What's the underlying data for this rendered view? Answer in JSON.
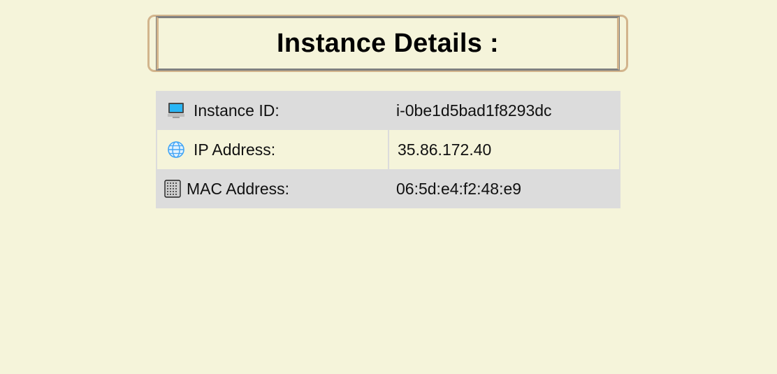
{
  "header": {
    "title": "Instance Details :"
  },
  "details": [
    {
      "icon": "computer-icon",
      "label": "Instance ID:",
      "value": "i-0be1d5bad1f8293dc"
    },
    {
      "icon": "globe-icon",
      "label": "IP Address:",
      "value": "35.86.172.40"
    },
    {
      "icon": "chip-icon",
      "label": "MAC Address:",
      "value": "06:5d:e4:f2:48:e9"
    }
  ],
  "colors": {
    "background": "#f5f4da",
    "row_shade": "#dcdcdc",
    "title_border": "#d2b48c"
  }
}
